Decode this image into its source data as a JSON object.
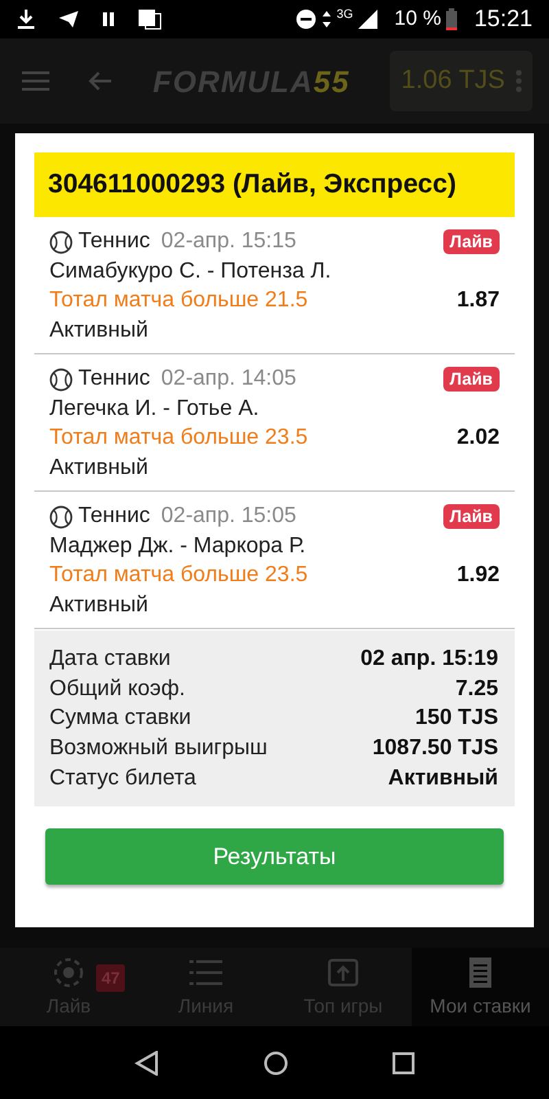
{
  "status_bar": {
    "network": "3G",
    "battery": "10 %",
    "time": "15:21"
  },
  "app_bar": {
    "brand": {
      "name": "FORMULA",
      "accent": "55"
    },
    "balance": "1.06 TJS"
  },
  "dialog": {
    "title": "304611000293 (Лайв, Экспресс)",
    "bets": [
      {
        "sport": "Теннис",
        "time": "02-апр. 15:15",
        "badge": "Лайв",
        "teams": "Симабукуро С. - Потенза Л.",
        "market": "Тотал матча больше 21.5",
        "odds": "1.87",
        "status": "Активный"
      },
      {
        "sport": "Теннис",
        "time": "02-апр. 14:05",
        "badge": "Лайв",
        "teams": "Легечка И. - Готье А.",
        "market": "Тотал матча больше 23.5",
        "odds": "2.02",
        "status": "Активный"
      },
      {
        "sport": "Теннис",
        "time": "02-апр. 15:05",
        "badge": "Лайв",
        "teams": "Маджер Дж. - Маркора Р.",
        "market": "Тотал матча больше 23.5",
        "odds": "1.92",
        "status": "Активный"
      }
    ],
    "summary": [
      {
        "label": "Дата ставки",
        "value": "02 апр. 15:19"
      },
      {
        "label": "Общий коэф.",
        "value": "7.25"
      },
      {
        "label": "Сумма ставки",
        "value": "150 TJS"
      },
      {
        "label": "Возможный выигрыш",
        "value": "1087.50 TJS"
      },
      {
        "label": "Статус билета",
        "value": "Активный"
      }
    ],
    "button": "Результаты"
  },
  "bottom_nav": [
    {
      "kind": "live",
      "label": "Лайв",
      "badge": "47",
      "selected": false
    },
    {
      "kind": "line",
      "label": "Линия",
      "selected": false
    },
    {
      "kind": "top",
      "label": "Топ игры",
      "selected": false
    },
    {
      "kind": "bets",
      "label": "Мои ставки",
      "selected": true
    }
  ]
}
